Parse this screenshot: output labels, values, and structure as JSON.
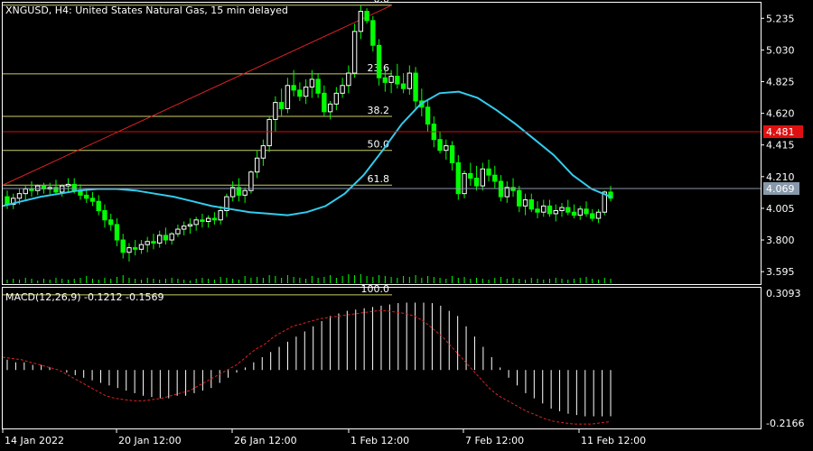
{
  "header": {
    "symbol_line": "XNGUSD, H4:  United States Natural Gas, 15 min delayed"
  },
  "macd": {
    "label": "MACD(12,26,9) -0.1212 -0.1569",
    "axis_top": "0.3093",
    "axis_bottom": "-0.2166"
  },
  "price_axis_labels": [
    "5.235",
    "5.030",
    "4.825",
    "4.620",
    "4.415",
    "4.210",
    "4.005",
    "3.800",
    "3.595"
  ],
  "price_tags": {
    "red_line": "4.481",
    "current": "4.069"
  },
  "fibonacci_levels": [
    "0.0",
    "23.6",
    "38.2",
    "50.0",
    "61.8",
    "100.0"
  ],
  "time_labels": [
    "14 Jan 2022",
    "20 Jan 12:00",
    "26 Jan 12:00",
    "1 Feb 12:00",
    "7 Feb 12:00",
    "11 Feb 12:00"
  ],
  "colors": {
    "background": "#000000",
    "frame": "#ffffff",
    "bull_candle": "#ffffff",
    "bear_candle": "#00ff00",
    "wick": "#00ff00",
    "moving_average": "#33ccee",
    "fib_level": "#cccc66",
    "fib_trend": "#dd2222",
    "red_price_line": "#cc1111",
    "current_price_line": "#8899aa",
    "volume": "#00ff00",
    "macd_hist": "#ffffff",
    "macd_signal": "#dd2222"
  },
  "chart_data": {
    "type": "candlestick",
    "symbol": "XNGUSD",
    "timeframe": "H4",
    "price_ylim": [
      3.52,
      5.33
    ],
    "grid": false,
    "red_price_line": 4.481,
    "current_price": 4.069,
    "ohlc": [
      [
        4.08,
        4.12,
        4.0,
        4.03
      ],
      [
        4.03,
        4.1,
        4.0,
        4.07
      ],
      [
        4.07,
        4.13,
        4.03,
        4.1
      ],
      [
        4.1,
        4.15,
        4.06,
        4.13
      ],
      [
        4.13,
        4.18,
        4.08,
        4.12
      ],
      [
        4.12,
        4.16,
        4.09,
        4.15
      ],
      [
        4.15,
        4.17,
        4.1,
        4.13
      ],
      [
        4.13,
        4.17,
        4.09,
        4.14
      ],
      [
        4.14,
        4.19,
        4.09,
        4.11
      ],
      [
        4.11,
        4.16,
        4.08,
        4.15
      ],
      [
        4.15,
        4.2,
        4.11,
        4.16
      ],
      [
        4.16,
        4.2,
        4.1,
        4.12
      ],
      [
        4.12,
        4.16,
        4.06,
        4.09
      ],
      [
        4.09,
        4.13,
        4.04,
        4.07
      ],
      [
        4.07,
        4.11,
        4.02,
        4.05
      ],
      [
        4.05,
        4.09,
        3.96,
        3.99
      ],
      [
        3.99,
        4.03,
        3.88,
        3.93
      ],
      [
        3.93,
        3.97,
        3.86,
        3.9
      ],
      [
        3.9,
        3.94,
        3.76,
        3.8
      ],
      [
        3.8,
        3.84,
        3.68,
        3.72
      ],
      [
        3.72,
        3.78,
        3.66,
        3.75
      ],
      [
        3.75,
        3.8,
        3.7,
        3.74
      ],
      [
        3.74,
        3.8,
        3.71,
        3.77
      ],
      [
        3.77,
        3.82,
        3.72,
        3.79
      ],
      [
        3.79,
        3.84,
        3.74,
        3.78
      ],
      [
        3.78,
        3.86,
        3.75,
        3.83
      ],
      [
        3.83,
        3.88,
        3.77,
        3.8
      ],
      [
        3.8,
        3.85,
        3.77,
        3.84
      ],
      [
        3.84,
        3.9,
        3.82,
        3.87
      ],
      [
        3.87,
        3.92,
        3.83,
        3.89
      ],
      [
        3.89,
        3.94,
        3.84,
        3.9
      ],
      [
        3.9,
        3.95,
        3.86,
        3.93
      ],
      [
        3.93,
        3.97,
        3.88,
        3.92
      ],
      [
        3.92,
        3.96,
        3.88,
        3.94
      ],
      [
        3.94,
        3.98,
        3.9,
        3.93
      ],
      [
        3.93,
        4.02,
        3.9,
        3.99
      ],
      [
        3.99,
        4.1,
        3.95,
        4.08
      ],
      [
        4.08,
        4.18,
        4.05,
        4.14
      ],
      [
        4.14,
        4.2,
        4.05,
        4.09
      ],
      [
        4.09,
        4.14,
        4.04,
        4.12
      ],
      [
        4.12,
        4.25,
        4.1,
        4.24
      ],
      [
        4.24,
        4.38,
        4.2,
        4.33
      ],
      [
        4.33,
        4.45,
        4.28,
        4.41
      ],
      [
        4.41,
        4.6,
        4.37,
        4.58
      ],
      [
        4.58,
        4.73,
        4.5,
        4.69
      ],
      [
        4.69,
        4.78,
        4.6,
        4.65
      ],
      [
        4.65,
        4.85,
        4.62,
        4.8
      ],
      [
        4.8,
        4.9,
        4.73,
        4.77
      ],
      [
        4.77,
        4.82,
        4.7,
        4.73
      ],
      [
        4.73,
        4.84,
        4.68,
        4.79
      ],
      [
        4.79,
        4.9,
        4.72,
        4.84
      ],
      [
        4.84,
        4.88,
        4.72,
        4.75
      ],
      [
        4.75,
        4.8,
        4.6,
        4.63
      ],
      [
        4.63,
        4.7,
        4.58,
        4.68
      ],
      [
        4.68,
        4.79,
        4.64,
        4.75
      ],
      [
        4.75,
        4.85,
        4.72,
        4.8
      ],
      [
        4.8,
        4.93,
        4.75,
        4.88
      ],
      [
        4.88,
        5.2,
        4.85,
        5.15
      ],
      [
        5.15,
        5.32,
        5.1,
        5.28
      ],
      [
        5.28,
        5.3,
        5.2,
        5.22
      ],
      [
        5.22,
        5.25,
        5.02,
        5.06
      ],
      [
        5.06,
        5.1,
        4.8,
        4.85
      ],
      [
        4.85,
        4.92,
        4.76,
        4.82
      ],
      [
        4.82,
        4.9,
        4.75,
        4.86
      ],
      [
        4.86,
        4.94,
        4.78,
        4.81
      ],
      [
        4.81,
        4.88,
        4.75,
        4.78
      ],
      [
        4.78,
        4.93,
        4.74,
        4.88
      ],
      [
        4.88,
        4.92,
        4.65,
        4.7
      ],
      [
        4.7,
        4.78,
        4.6,
        4.66
      ],
      [
        4.66,
        4.7,
        4.5,
        4.55
      ],
      [
        4.55,
        4.6,
        4.4,
        4.45
      ],
      [
        4.45,
        4.5,
        4.36,
        4.38
      ],
      [
        4.38,
        4.45,
        4.32,
        4.41
      ],
      [
        4.41,
        4.44,
        4.25,
        4.3
      ],
      [
        4.3,
        4.35,
        4.06,
        4.1
      ],
      [
        4.1,
        4.25,
        4.07,
        4.23
      ],
      [
        4.23,
        4.3,
        4.15,
        4.2
      ],
      [
        4.2,
        4.28,
        4.12,
        4.15
      ],
      [
        4.15,
        4.3,
        4.12,
        4.26
      ],
      [
        4.26,
        4.32,
        4.18,
        4.22
      ],
      [
        4.22,
        4.28,
        4.13,
        4.18
      ],
      [
        4.18,
        4.22,
        4.05,
        4.08
      ],
      [
        4.08,
        4.18,
        4.04,
        4.14
      ],
      [
        4.14,
        4.2,
        4.08,
        4.12
      ],
      [
        4.12,
        4.15,
        3.98,
        4.02
      ],
      [
        4.02,
        4.1,
        3.96,
        4.06
      ],
      [
        4.06,
        4.1,
        3.98,
        4.0
      ],
      [
        4.0,
        4.05,
        3.94,
        3.98
      ],
      [
        3.98,
        4.06,
        3.95,
        4.02
      ],
      [
        4.02,
        4.06,
        3.95,
        3.97
      ],
      [
        3.97,
        4.03,
        3.92,
        3.99
      ],
      [
        3.99,
        4.04,
        3.95,
        4.01
      ],
      [
        4.01,
        4.06,
        3.96,
        3.98
      ],
      [
        3.98,
        4.03,
        3.94,
        3.96
      ],
      [
        3.96,
        4.02,
        3.93,
        4.0
      ],
      [
        4.0,
        4.05,
        3.95,
        3.97
      ],
      [
        3.97,
        4.0,
        3.92,
        3.94
      ],
      [
        3.94,
        4.0,
        3.91,
        3.98
      ],
      [
        3.98,
        4.12,
        3.96,
        4.11
      ],
      [
        4.11,
        4.15,
        4.05,
        4.07
      ]
    ],
    "moving_average": [
      4.02,
      4.05,
      4.08,
      4.1,
      4.12,
      4.13,
      4.13,
      4.12,
      4.1,
      4.08,
      4.05,
      4.02,
      4.0,
      3.98,
      3.97,
      3.96,
      3.98,
      4.02,
      4.1,
      4.22,
      4.38,
      4.55,
      4.68,
      4.75,
      4.76,
      4.72,
      4.64,
      4.55,
      4.45,
      4.35,
      4.22,
      4.13,
      4.08
    ],
    "fibonacci": {
      "levels": [
        "0.0",
        "23.6",
        "38.2",
        "50.0",
        "61.8",
        "100.0"
      ],
      "prices": [
        5.32,
        4.875,
        4.6,
        4.38,
        4.155,
        3.445
      ]
    },
    "volume": [
      4,
      5,
      4,
      6,
      5,
      3,
      5,
      4,
      6,
      5,
      4,
      5,
      6,
      8,
      5,
      4,
      6,
      5,
      7,
      9,
      6,
      5,
      4,
      6,
      5,
      4,
      5,
      6,
      5,
      4,
      3,
      5,
      6,
      5,
      4,
      7,
      6,
      5,
      4,
      8,
      6,
      7,
      6,
      9,
      8,
      6,
      9,
      7,
      6,
      5,
      8,
      6,
      7,
      9,
      6,
      8,
      10,
      9,
      10,
      8,
      7,
      9,
      8,
      7,
      6,
      8,
      7,
      9,
      6,
      8,
      7,
      6,
      5,
      8,
      6,
      7,
      5,
      6,
      5,
      4,
      6,
      7,
      5,
      6,
      5,
      4,
      6,
      5,
      4,
      5,
      6,
      5,
      4,
      5,
      6,
      7,
      5,
      4,
      6,
      5
    ],
    "volume_peak": 30,
    "macd": {
      "hist": [
        0.04,
        0.03,
        0.03,
        0.02,
        0.02,
        0.01,
        0.0,
        -0.01,
        -0.02,
        -0.03,
        -0.04,
        -0.05,
        -0.06,
        -0.07,
        -0.08,
        -0.09,
        -0.1,
        -0.105,
        -0.11,
        -0.11,
        -0.1,
        -0.1,
        -0.09,
        -0.08,
        -0.07,
        -0.05,
        -0.03,
        -0.01,
        0.01,
        0.03,
        0.05,
        0.07,
        0.09,
        0.11,
        0.13,
        0.15,
        0.17,
        0.19,
        0.21,
        0.22,
        0.23,
        0.235,
        0.24,
        0.245,
        0.25,
        0.255,
        0.26,
        0.262,
        0.262,
        0.262,
        0.26,
        0.25,
        0.23,
        0.21,
        0.17,
        0.13,
        0.09,
        0.05,
        0.01,
        -0.03,
        -0.06,
        -0.09,
        -0.11,
        -0.13,
        -0.15,
        -0.16,
        -0.17,
        -0.175,
        -0.18,
        -0.18,
        -0.18,
        -0.18
      ],
      "signal": [
        0.05,
        0.045,
        0.04,
        0.03,
        0.02,
        0.01,
        0.0,
        -0.02,
        -0.04,
        -0.06,
        -0.08,
        -0.1,
        -0.11,
        -0.115,
        -0.12,
        -0.12,
        -0.115,
        -0.11,
        -0.1,
        -0.09,
        -0.08,
        -0.06,
        -0.04,
        -0.02,
        0.0,
        0.02,
        0.05,
        0.08,
        0.1,
        0.13,
        0.15,
        0.17,
        0.18,
        0.19,
        0.2,
        0.205,
        0.21,
        0.215,
        0.22,
        0.225,
        0.23,
        0.23,
        0.225,
        0.22,
        0.21,
        0.19,
        0.16,
        0.13,
        0.09,
        0.05,
        0.01,
        -0.03,
        -0.07,
        -0.1,
        -0.12,
        -0.14,
        -0.16,
        -0.175,
        -0.19,
        -0.2,
        -0.205,
        -0.21,
        -0.21,
        -0.21,
        -0.205,
        -0.2
      ],
      "ylim": [
        -0.2166,
        0.3093
      ]
    }
  }
}
